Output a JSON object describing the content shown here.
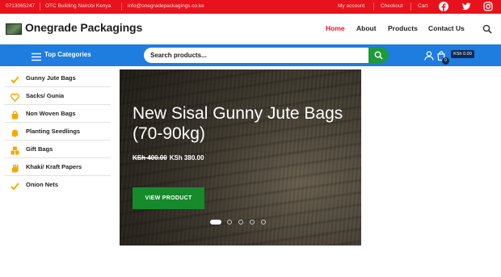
{
  "topbar": {
    "phone": "0713065247",
    "address": "OTC Building Nairobi Kenya",
    "email": "info@onegradepackagings.co.ke",
    "links": [
      "My account",
      "Checkout",
      "Cart"
    ],
    "social": [
      "facebook-icon",
      "twitter-icon",
      "instagram-icon"
    ]
  },
  "header": {
    "logo_text": "Onegrade Packagings",
    "nav": [
      "Home",
      "About",
      "Products",
      "Contact Us"
    ],
    "active_nav": "Home"
  },
  "catbar": {
    "top_categories_label": "Top Categories",
    "search_placeholder": "Search products...",
    "cart_count": "0",
    "cart_total": "KSh 0.00"
  },
  "sidebar": {
    "items": [
      {
        "label": "Gunny Jute Bags",
        "icon": "check-icon"
      },
      {
        "label": "Sacks/ Gunia",
        "icon": "heart-icon"
      },
      {
        "label": "Non Woven Bags",
        "icon": "bag-icon"
      },
      {
        "label": "Planting Seedlings",
        "icon": "bell-icon"
      },
      {
        "label": "Gift Bags",
        "icon": "boxes-icon"
      },
      {
        "label": "Khaki/ Kraft Papers",
        "icon": "hand-icon"
      },
      {
        "label": "Onion Nets",
        "icon": "check-icon"
      }
    ]
  },
  "slider": {
    "title": "New Sisal Gunny Jute Bags (70-90kg)",
    "old_price": "KSh 400.00",
    "new_price": "KSh 380.00",
    "button_label": "VIEW PRODUCT",
    "dot_count": 5,
    "active_dot": 0
  },
  "colors": {
    "topbar": "#e8121c",
    "catbar": "#1f7de0",
    "search_button": "#1f9a3a",
    "view_button": "#178a2c",
    "icon_accent": "#f5a800",
    "nav_active": "#e8121c"
  }
}
